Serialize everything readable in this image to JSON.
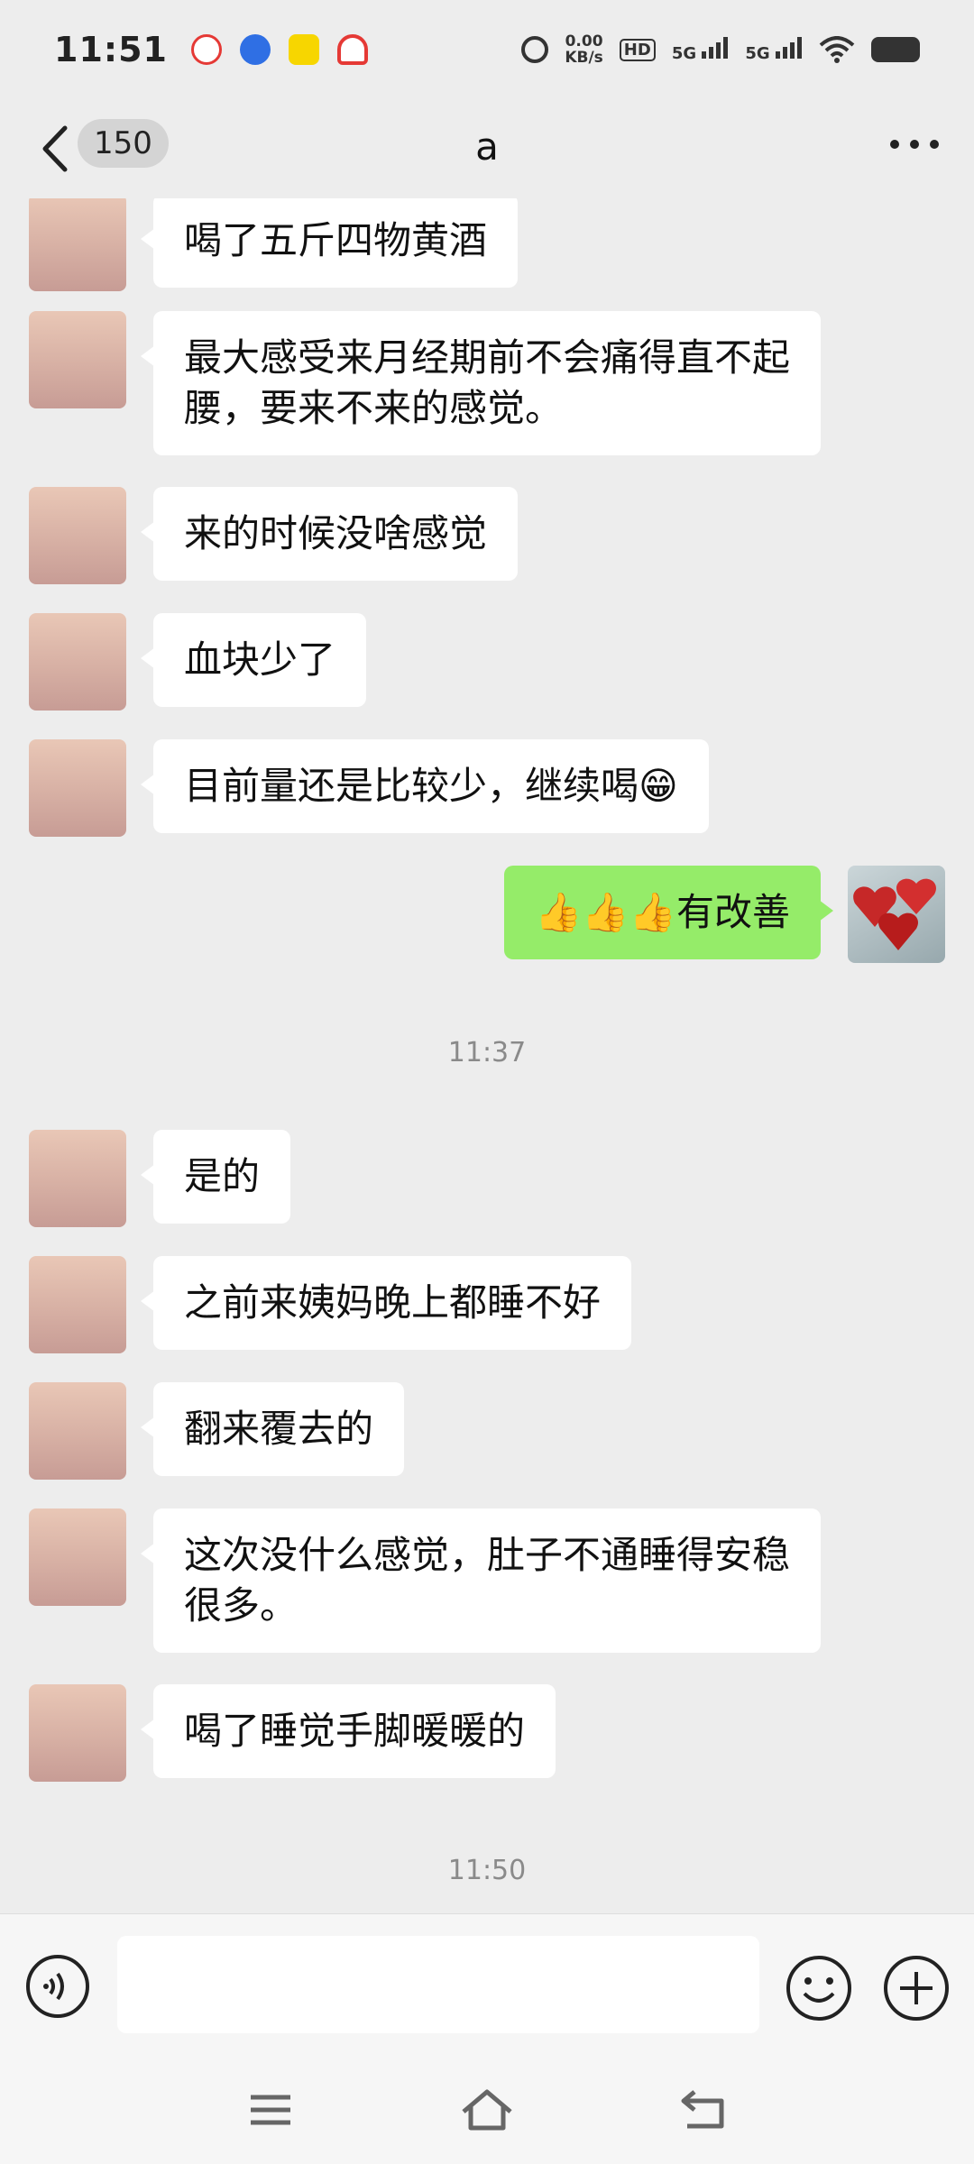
{
  "status_bar": {
    "time": "11:51",
    "net_speed_value": "0.00",
    "net_speed_unit": "KB/s",
    "hd_label": "HD",
    "sim1": "5G",
    "sim2": "5G"
  },
  "header": {
    "unread_count": "150",
    "title": "a"
  },
  "messages": [
    {
      "side": "in",
      "text": "喝了五斤四物黄酒"
    },
    {
      "side": "in",
      "text": "最大感受来月经期前不会痛得直不起腰，要来不来的感觉。"
    },
    {
      "side": "in",
      "text": "来的时候没啥感觉"
    },
    {
      "side": "in",
      "text": "血块少了"
    },
    {
      "side": "in",
      "text": "目前量还是比较少，继续喝😁"
    },
    {
      "side": "out",
      "text": "👍👍👍有改善"
    },
    {
      "side": "time",
      "text": "11:37"
    },
    {
      "side": "in",
      "text": "是的"
    },
    {
      "side": "in",
      "text": "之前来姨妈晚上都睡不好"
    },
    {
      "side": "in",
      "text": "翻来覆去的"
    },
    {
      "side": "in",
      "text": "这次没什么感觉，肚子不通睡得安稳很多。"
    },
    {
      "side": "in",
      "text": "喝了睡觉手脚暖暖的"
    },
    {
      "side": "time",
      "text": "11:50"
    }
  ],
  "input": {
    "value": "",
    "placeholder": ""
  },
  "icons": {
    "back": "chevron-left-icon",
    "more": "more-horizontal-icon",
    "voice": "voice-icon",
    "emoji": "emoji-icon",
    "plus": "plus-icon",
    "nav_menu": "menu-icon",
    "nav_home": "home-icon",
    "nav_back": "return-icon"
  },
  "colors": {
    "outgoing_bubble": "#95ec69",
    "incoming_bubble": "#ffffff",
    "background": "#ededed"
  }
}
